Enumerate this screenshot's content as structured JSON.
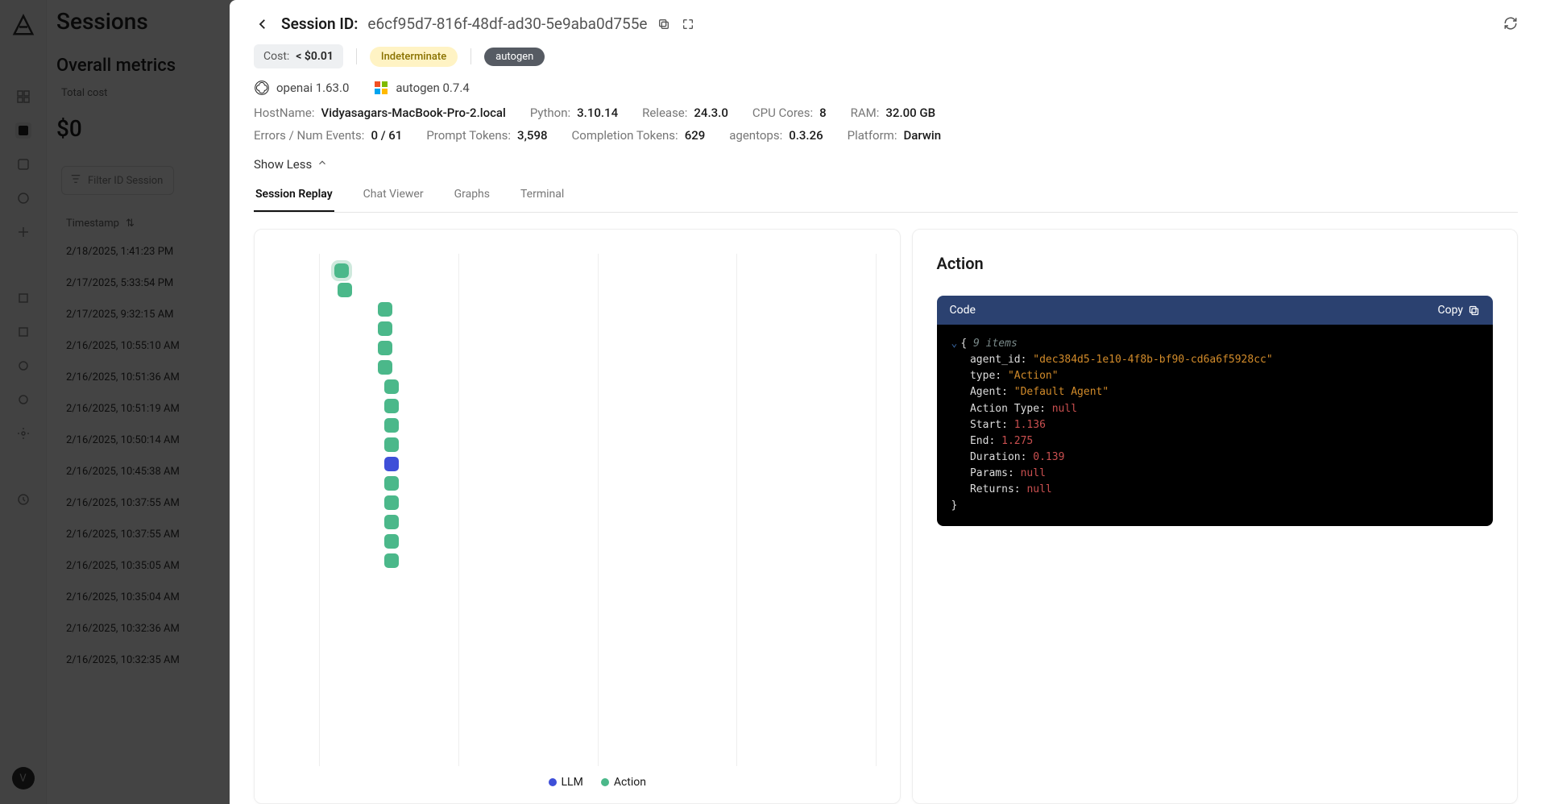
{
  "bg": {
    "title": "Sessions",
    "subtitle": "Overall metrics",
    "total_cost_label": "Total cost",
    "total_cost_value": "$0",
    "filter_placeholder": "Filter ID Session",
    "timestamp_header": "Timestamp",
    "avatar_initial": "V",
    "sessions": [
      "2/18/2025, 1:41:23 PM",
      "2/17/2025, 5:33:54 PM",
      "2/17/2025, 9:32:15 AM",
      "2/16/2025, 10:55:10 AM",
      "2/16/2025, 10:51:36 AM",
      "2/16/2025, 10:51:19 AM",
      "2/16/2025, 10:50:14 AM",
      "2/16/2025, 10:45:38 AM",
      "2/16/2025, 10:37:55 AM",
      "2/16/2025, 10:37:55 AM",
      "2/16/2025, 10:35:05 AM",
      "2/16/2025, 10:35:04 AM",
      "2/16/2025, 10:32:36 AM",
      "2/16/2025, 10:32:35 AM"
    ]
  },
  "header": {
    "label": "Session ID:",
    "id": "e6cf95d7-816f-48df-ad30-5e9aba0d755e"
  },
  "badges": {
    "cost_label": "Cost:",
    "cost_value": "< $0.01",
    "status": "Indeterminate",
    "agent_tag": "autogen"
  },
  "sdk": {
    "openai": "openai 1.63.0",
    "autogen": "autogen 0.7.4"
  },
  "meta": {
    "hostname_label": "HostName:",
    "hostname": "Vidyasagars-MacBook-Pro-2.local",
    "python_label": "Python:",
    "python": "3.10.14",
    "release_label": "Release:",
    "release": "24.3.0",
    "cpu_label": "CPU Cores:",
    "cpu": "8",
    "ram_label": "RAM:",
    "ram": "32.00 GB",
    "errors_label": "Errors / Num Events:",
    "errors": "0 / 61",
    "prompt_label": "Prompt Tokens:",
    "prompt": "3,598",
    "completion_label": "Completion Tokens:",
    "completion": "629",
    "agentops_label": "agentops:",
    "agentops": "0.3.26",
    "platform_label": "Platform:",
    "platform": "Darwin"
  },
  "show_less": "Show Less",
  "tabs": {
    "replay": "Session Replay",
    "chat": "Chat Viewer",
    "graphs": "Graphs",
    "terminal": "Terminal"
  },
  "legend": {
    "llm": "LLM",
    "action": "Action"
  },
  "waterfall": [
    {
      "type": "action",
      "offset": 18,
      "selected": true
    },
    {
      "type": "action",
      "offset": 22
    },
    {
      "type": "action",
      "offset": 72
    },
    {
      "type": "action",
      "offset": 72
    },
    {
      "type": "action",
      "offset": 72
    },
    {
      "type": "action",
      "offset": 72
    },
    {
      "type": "action",
      "offset": 80
    },
    {
      "type": "action",
      "offset": 80
    },
    {
      "type": "action",
      "offset": 80
    },
    {
      "type": "action",
      "offset": 80
    },
    {
      "type": "llm",
      "offset": 80
    },
    {
      "type": "action",
      "offset": 80
    },
    {
      "type": "action",
      "offset": 80
    },
    {
      "type": "action",
      "offset": 80
    },
    {
      "type": "action",
      "offset": 80
    },
    {
      "type": "action",
      "offset": 80
    }
  ],
  "action": {
    "title": "Action",
    "code_label": "Code",
    "copy_label": "Copy",
    "item_count": "9 items",
    "fields": {
      "agent_id_k": "agent_id:",
      "agent_id_v": "\"dec384d5-1e10-4f8b-bf90-cd6a6f5928cc\"",
      "type_k": "type:",
      "type_v": "\"Action\"",
      "agent_k": "Agent:",
      "agent_v": "\"Default Agent\"",
      "action_type_k": "Action Type:",
      "action_type_v": "null",
      "start_k": "Start:",
      "start_v": "1.136",
      "end_k": "End:",
      "end_v": "1.275",
      "duration_k": "Duration:",
      "duration_v": "0.139",
      "params_k": "Params:",
      "params_v": "null",
      "returns_k": "Returns:",
      "returns_v": "null"
    }
  }
}
